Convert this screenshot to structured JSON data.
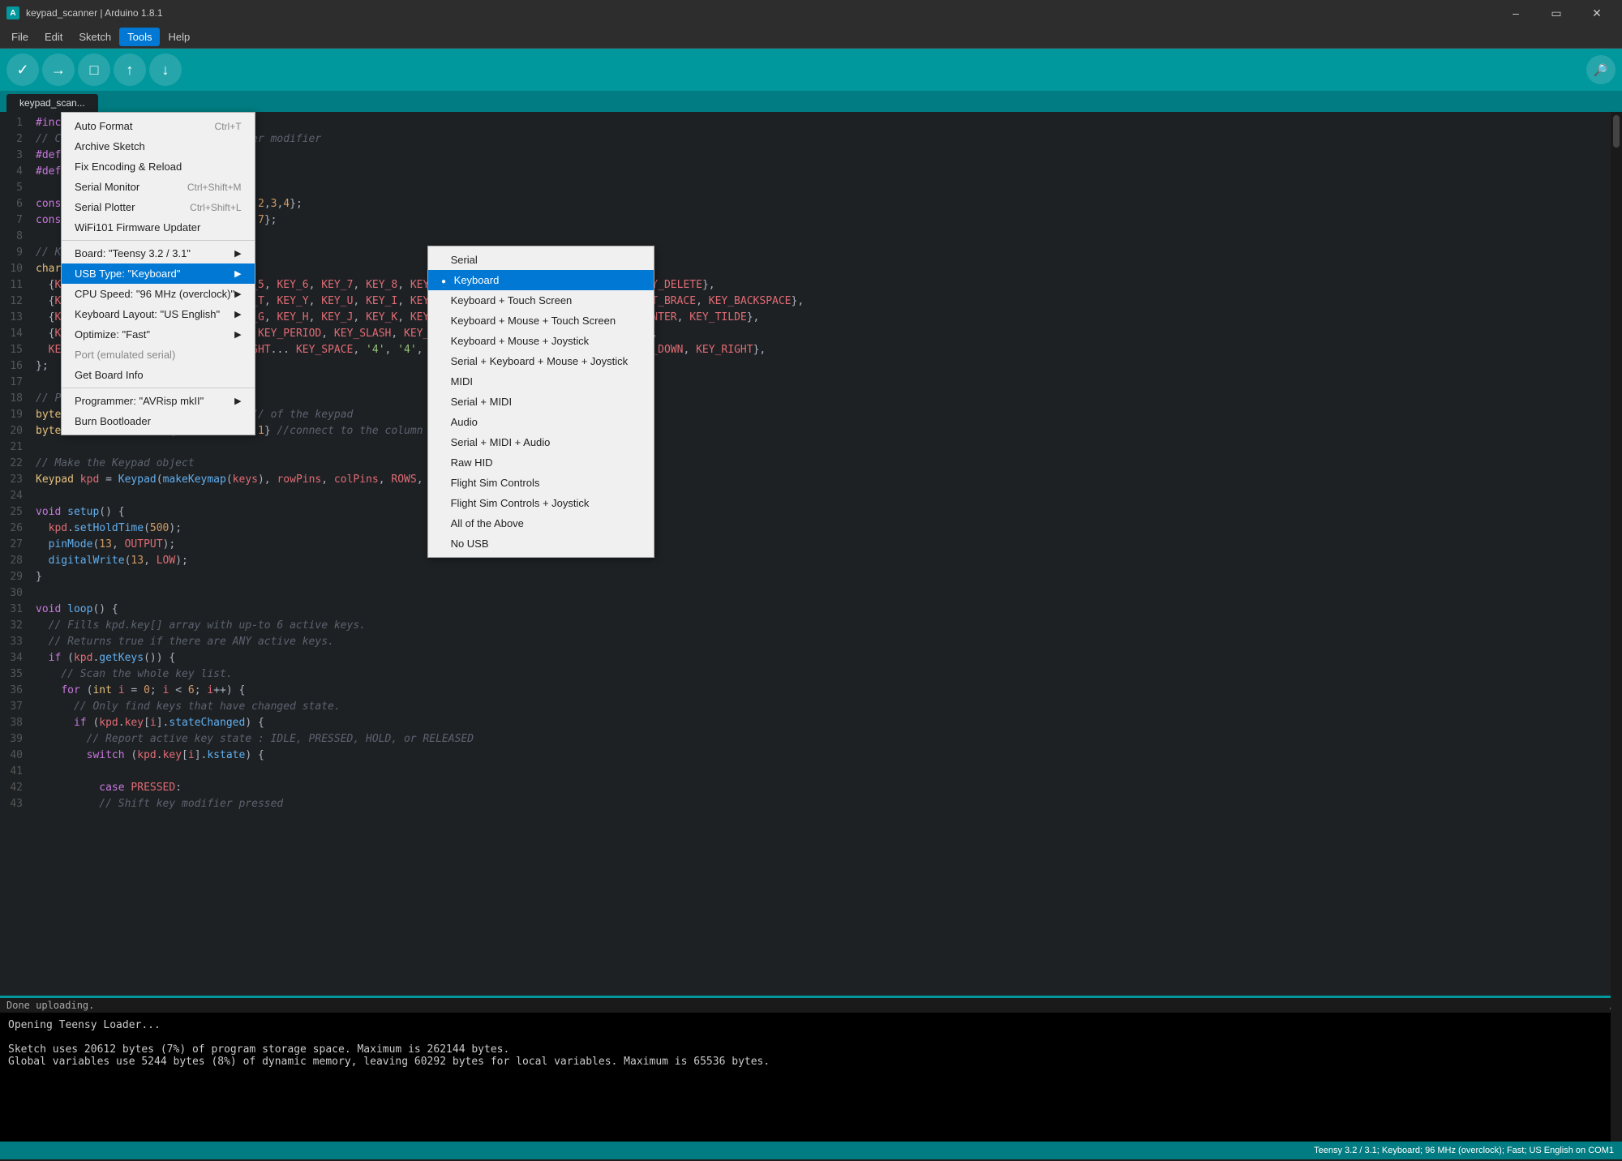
{
  "titleBar": {
    "title": "keypad_scanner | Arduino 1.8.1",
    "icon": "A"
  },
  "menuBar": {
    "items": [
      "File",
      "Edit",
      "Sketch",
      "Tools",
      "Help"
    ]
  },
  "toolbar": {
    "buttons": [
      "verify",
      "upload",
      "new",
      "open",
      "save"
    ]
  },
  "tab": {
    "name": "keypad_scan..."
  },
  "toolsMenu": {
    "items": [
      {
        "label": "Auto Format",
        "shortcut": "Ctrl+T",
        "hasArrow": false
      },
      {
        "label": "Archive Sketch",
        "shortcut": "",
        "hasArrow": false
      },
      {
        "label": "Fix Encoding & Reload",
        "shortcut": "",
        "hasArrow": false
      },
      {
        "label": "Serial Monitor",
        "shortcut": "Ctrl+Shift+M",
        "hasArrow": false
      },
      {
        "label": "Serial Plotter",
        "shortcut": "Ctrl+Shift+L",
        "hasArrow": false
      },
      {
        "label": "WiFi101 Firmware Updater",
        "shortcut": "",
        "hasArrow": false
      },
      {
        "label": "separator1"
      },
      {
        "label": "Board: \"Teensy 3.2 / 3.1\"",
        "shortcut": "",
        "hasArrow": true
      },
      {
        "label": "USB Type: \"Keyboard\"",
        "shortcut": "",
        "hasArrow": true,
        "highlighted": true
      },
      {
        "label": "CPU Speed: \"96 MHz (overclock)\"",
        "shortcut": "",
        "hasArrow": true
      },
      {
        "label": "Keyboard Layout: \"US English\"",
        "shortcut": "",
        "hasArrow": true
      },
      {
        "label": "Optimize: \"Fast\"",
        "shortcut": "",
        "hasArrow": true
      },
      {
        "label": "Port (emulated serial)",
        "shortcut": "",
        "hasArrow": false,
        "disabled": true
      },
      {
        "label": "Get Board Info",
        "shortcut": "",
        "hasArrow": false
      },
      {
        "label": "separator2"
      },
      {
        "label": "Programmer: \"AVRisp mkII\"",
        "shortcut": "",
        "hasArrow": true
      },
      {
        "label": "Burn Bootloader",
        "shortcut": "",
        "hasArrow": false
      }
    ]
  },
  "usbSubmenu": {
    "items": [
      {
        "label": "Serial",
        "selected": false
      },
      {
        "label": "Keyboard",
        "selected": true,
        "highlighted": true
      },
      {
        "label": "Keyboard + Touch Screen",
        "selected": false
      },
      {
        "label": "Keyboard + Mouse + Touch Screen",
        "selected": false
      },
      {
        "label": "Keyboard + Mouse + Joystick",
        "selected": false
      },
      {
        "label": "Serial + Keyboard + Mouse + Joystick",
        "selected": false
      },
      {
        "label": "MIDI",
        "selected": false
      },
      {
        "label": "Serial + MIDI",
        "selected": false
      },
      {
        "label": "Audio",
        "selected": false
      },
      {
        "label": "Serial + MIDI + Audio",
        "selected": false
      },
      {
        "label": "Raw HID",
        "selected": false
      },
      {
        "label": "Flight Sim Controls",
        "selected": false
      },
      {
        "label": "Flight Sim Controls + Joystick",
        "selected": false
      },
      {
        "label": "All of the Above",
        "selected": false
      },
      {
        "label": "No USB",
        "selected": false
      }
    ]
  },
  "output": {
    "status": "Done uploading.",
    "lines": [
      "Opening Teensy Loader...",
      "",
      "Sketch uses 20612 bytes (7%) of program storage space. Maximum is 262144 bytes.",
      "Global variables use 5244 bytes (8%) of dynamic memory, leaving 60292 bytes for local variables. Maximum is 65536 bytes."
    ]
  },
  "statusBar": {
    "text": "Teensy 3.2 / 3.1; Keyboard; 96 MHz (overclock); Fast; US English on COM1"
  }
}
